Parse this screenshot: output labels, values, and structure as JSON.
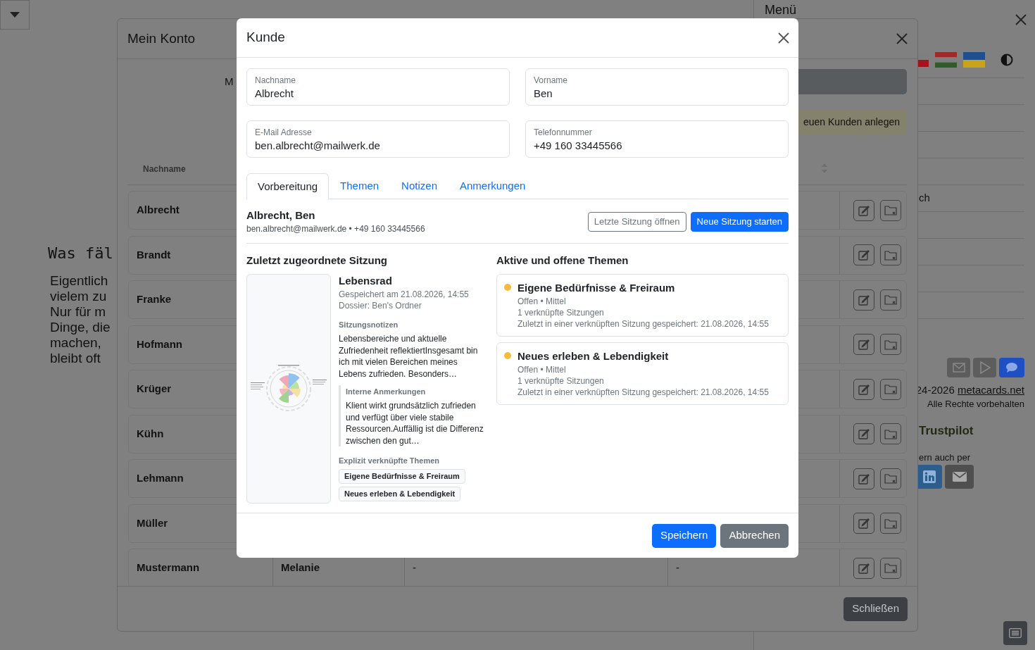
{
  "page": {
    "heading": "Was fäl",
    "paragraph": "Eigentlich\nvielem zu\nNur für m\nDinge, die\nmachen,\nbleibt oft"
  },
  "menu_panel": {
    "title": "Menü",
    "item_fragment": "ch",
    "copyright": "24-2026",
    "copyright_link": "metacards.net",
    "rights": "Alle Rechte vorbehalten",
    "trustpilot": "Trustpilot",
    "share_label": "ern auch per"
  },
  "account_modal": {
    "title": "Mein Konto",
    "heading_fragment": "M",
    "new_customer_button": "euen Kunden anlegen",
    "table": {
      "columns": [
        "Nachname"
      ],
      "rows": [
        {
          "last_name": "Albrecht"
        },
        {
          "last_name": "Brandt"
        },
        {
          "last_name": "Franke"
        },
        {
          "last_name": "Hofmann"
        },
        {
          "last_name": "Krüger"
        },
        {
          "last_name": "Kühn"
        },
        {
          "last_name": "Lehmann"
        },
        {
          "last_name": "Müller"
        },
        {
          "last_name": "Mustermann",
          "first_name": "Melanie",
          "column_3": "-",
          "column_4": "-"
        }
      ]
    },
    "close_button": "Schließen"
  },
  "customer_modal": {
    "title": "Kunde",
    "fields": [
      {
        "label": "Nachname",
        "value": "Albrecht"
      },
      {
        "label": "Vorname",
        "value": "Ben"
      },
      {
        "label": "E-Mail Adresse",
        "value": "ben.albrecht@mailwerk.de"
      },
      {
        "label": "Telefonnummer",
        "value": "+49 160 33445566"
      }
    ],
    "tabs": [
      {
        "label": "Vorbereitung",
        "selected": true
      },
      {
        "label": "Themen",
        "selected": false
      },
      {
        "label": "Notizen",
        "selected": false
      },
      {
        "label": "Anmerkungen",
        "selected": false
      }
    ],
    "client": {
      "name": "Albrecht, Ben",
      "contact": "ben.albrecht@mailwerk.de • +49 160 33445566"
    },
    "actions": [
      {
        "label": "Letzte Sitzung öffnen",
        "kind": "outline"
      },
      {
        "label": "Neue Sitzung starten",
        "kind": "primary"
      }
    ],
    "last_session": {
      "heading": "Zuletzt zugeordnete Sitzung",
      "title": "Lebensrad",
      "saved": "Gespeichert am 21.08.2026, 14:55",
      "dossier": "Dossier: Ben's Ordner",
      "notes_label": "Sitzungsnotizen",
      "notes": "Lebensbereiche und aktuelle Zufriedenheit reflektiertInsgesamt bin ich mit vielen Bereichen meines Lebens zufrieden. Besonders…",
      "internal_label": "Interne Anmerkungen",
      "internal_notes": "Klient wirkt grundsätzlich zufrieden und verfügt über viele stabile Ressourcen.Auffällig ist die Differenz zwischen den gut…",
      "topics_label": "Explizit verknüpfte Themen",
      "topics": [
        "Eigene Bedürfnisse & Freiraum",
        "Neues erleben & Lebendigkeit"
      ]
    },
    "themes": {
      "heading": "Aktive und offene Themen",
      "items": [
        {
          "title": "Eigene Bedürfnisse & Freiraum",
          "color": "#f4bb3c",
          "status": "Offen • Mittel",
          "sessions": "1 verknüpfte Sitzungen",
          "last_saved": "Zuletzt in einer verknüpften Sitzung gespeichert: 21.08.2026, 14:55"
        },
        {
          "title": "Neues erleben & Lebendigkeit",
          "color": "#f4bb3c",
          "status": "Offen • Mittel",
          "sessions": "1 verknüpfte Sitzungen",
          "last_saved": "Zuletzt in einer verknüpften Sitzung gespeichert: 21.08.2026, 14:55"
        }
      ]
    },
    "footer": [
      {
        "label": "Speichern",
        "kind": "primary"
      },
      {
        "label": "Abbrechen",
        "kind": "secondary"
      }
    ]
  }
}
